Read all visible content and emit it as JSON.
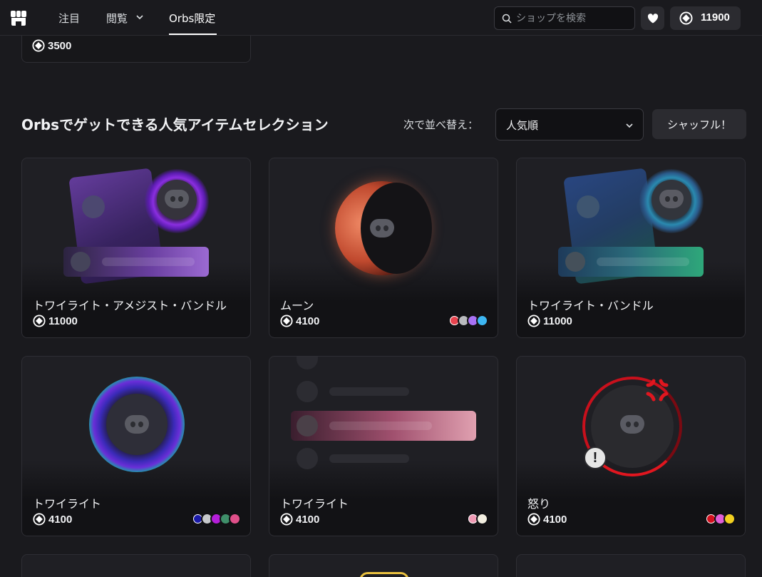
{
  "nav": {
    "items": [
      "注目",
      "閲覧",
      "Orbs限定"
    ],
    "active_index": 2
  },
  "search": {
    "placeholder": "ショップを検索"
  },
  "orbs_balance": "11900",
  "prev_card": {
    "price": "3500"
  },
  "section": {
    "title": "Orbsでゲットできる人気アイテムセレクション",
    "sort_label": "次で並べ替え：",
    "sort_value": "人気順",
    "shuffle_label": "シャッフル！"
  },
  "cards": [
    {
      "name": "トワイライト・アメジスト・バンドル",
      "price": "11000",
      "swatches": []
    },
    {
      "name": "ムーン",
      "price": "4100",
      "swatches": [
        "#e8434e",
        "#b9bbbe",
        "#a872f5",
        "#3db6f2"
      ]
    },
    {
      "name": "トワイライト・バンドル",
      "price": "11000",
      "swatches": []
    },
    {
      "name": "トワイライト",
      "price": "4100",
      "swatches": [
        "#1a1aa8",
        "#c7c9cc",
        "#b51ed9",
        "#3f8f6a",
        "#e0508a"
      ]
    },
    {
      "name": "トワイライト",
      "price": "4100",
      "swatches": [
        "#f09ab4",
        "#f2eee0"
      ]
    },
    {
      "name": "怒り",
      "price": "4100",
      "swatches": [
        "#d40f1e",
        "#e15fd7",
        "#f2d020"
      ]
    }
  ],
  "colors": {
    "background": "#1a1a1e",
    "card": "#1f1f24",
    "accent_red": "#e0161f"
  }
}
